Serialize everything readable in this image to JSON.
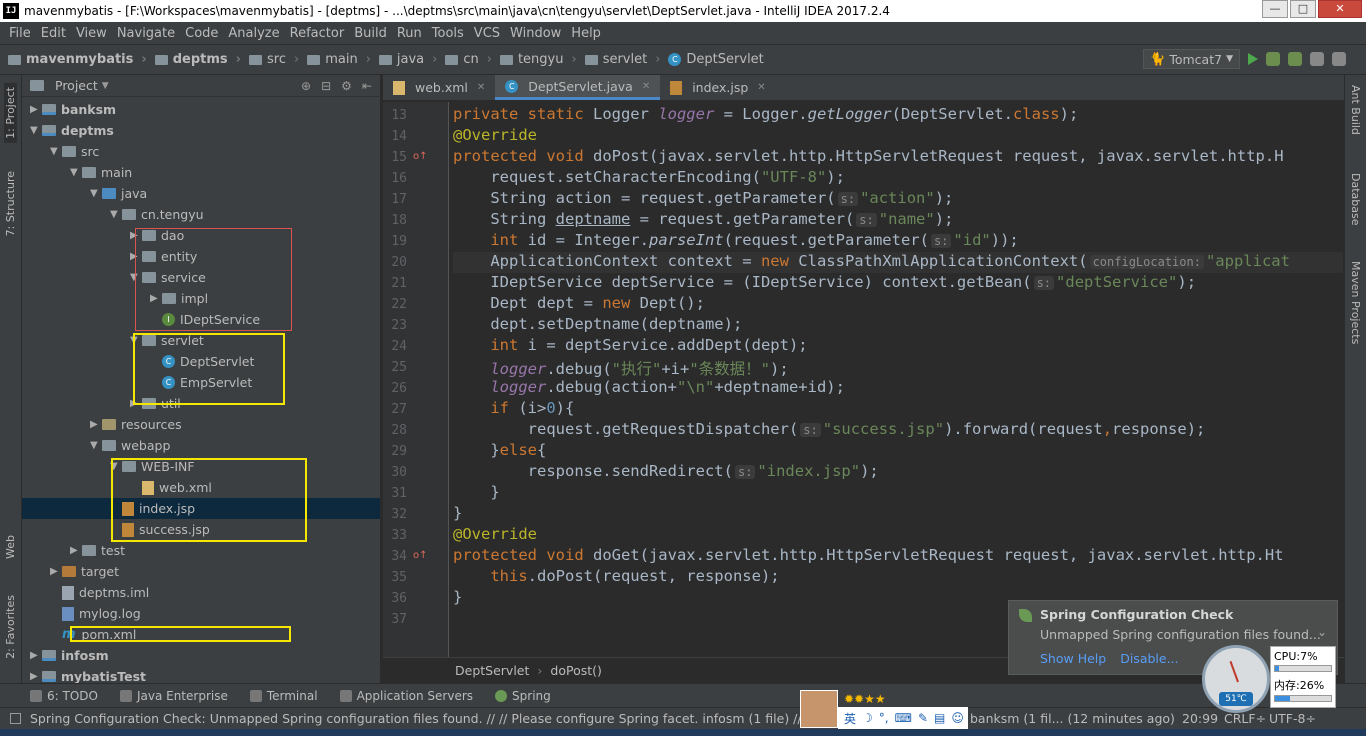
{
  "window": {
    "title": "mavenmybatis - [F:\\Workspaces\\mavenmybatis] - [deptms] - ...\\deptms\\src\\main\\java\\cn\\tengyu\\servlet\\DeptServlet.java - IntelliJ IDEA 2017.2.4",
    "logo": "IJ",
    "buttons": {
      "minimize": "—",
      "maximize": "□",
      "close": "✕"
    }
  },
  "menu": [
    "File",
    "Edit",
    "View",
    "Navigate",
    "Code",
    "Analyze",
    "Refactor",
    "Build",
    "Run",
    "Tools",
    "VCS",
    "Window",
    "Help"
  ],
  "breadcrumbs": [
    "mavenmybatis",
    "deptms",
    "src",
    "main",
    "java",
    "cn",
    "tengyu",
    "servlet",
    "DeptServlet"
  ],
  "run_config": "Tomcat7",
  "left_strip": {
    "project": "1: Project",
    "structure": "7: Structure",
    "web": "Web",
    "favorites": "2: Favorites"
  },
  "right_strip": {
    "ant": "Ant Build",
    "database": "Database",
    "maven": "Maven Projects"
  },
  "project_panel": {
    "title": "Project",
    "items": [
      {
        "label": "banksm",
        "depth": 1,
        "kind": "module",
        "expanded": false,
        "bold": true
      },
      {
        "label": "deptms",
        "depth": 1,
        "kind": "module",
        "expanded": true,
        "bold": true
      },
      {
        "label": "src",
        "depth": 2,
        "kind": "folder",
        "expanded": true
      },
      {
        "label": "main",
        "depth": 3,
        "kind": "folder",
        "expanded": true
      },
      {
        "label": "java",
        "depth": 4,
        "kind": "src",
        "expanded": true
      },
      {
        "label": "cn.tengyu",
        "depth": 5,
        "kind": "package",
        "expanded": true
      },
      {
        "label": "dao",
        "depth": 6,
        "kind": "package",
        "expanded": false
      },
      {
        "label": "entity",
        "depth": 6,
        "kind": "package",
        "expanded": false
      },
      {
        "label": "service",
        "depth": 6,
        "kind": "package",
        "expanded": true
      },
      {
        "label": "impl",
        "depth": 7,
        "kind": "package",
        "expanded": false
      },
      {
        "label": "IDeptService",
        "depth": 7,
        "kind": "interface"
      },
      {
        "label": "servlet",
        "depth": 6,
        "kind": "package",
        "expanded": true
      },
      {
        "label": "DeptServlet",
        "depth": 7,
        "kind": "class"
      },
      {
        "label": "EmpServlet",
        "depth": 7,
        "kind": "class"
      },
      {
        "label": "util",
        "depth": 6,
        "kind": "package",
        "expanded": false
      },
      {
        "label": "resources",
        "depth": 4,
        "kind": "res",
        "expanded": false
      },
      {
        "label": "webapp",
        "depth": 4,
        "kind": "folder",
        "expanded": true
      },
      {
        "label": "WEB-INF",
        "depth": 5,
        "kind": "folder",
        "expanded": true
      },
      {
        "label": "web.xml",
        "depth": 6,
        "kind": "xml"
      },
      {
        "label": "index.jsp",
        "depth": 5,
        "kind": "jsp",
        "selected": true
      },
      {
        "label": "success.jsp",
        "depth": 5,
        "kind": "jsp"
      },
      {
        "label": "test",
        "depth": 3,
        "kind": "folder",
        "expanded": false
      },
      {
        "label": "target",
        "depth": 2,
        "kind": "target",
        "expanded": false
      },
      {
        "label": "deptms.iml",
        "depth": 2,
        "kind": "iml"
      },
      {
        "label": "mylog.log",
        "depth": 2,
        "kind": "log"
      },
      {
        "label": "pom.xml",
        "depth": 2,
        "kind": "maven"
      },
      {
        "label": "infosm",
        "depth": 1,
        "kind": "module",
        "expanded": false,
        "bold": true
      },
      {
        "label": "mybatisTest",
        "depth": 1,
        "kind": "module",
        "expanded": false,
        "bold": true
      }
    ]
  },
  "editor_tabs": [
    {
      "label": "web.xml",
      "active": false
    },
    {
      "label": "DeptServlet.java",
      "active": true
    },
    {
      "label": "index.jsp",
      "active": false
    }
  ],
  "code_lines": [
    {
      "n": "13",
      "t": [
        [
          "kw",
          "private static "
        ],
        [
          "",
          "Logger "
        ],
        [
          "fld",
          "logger"
        ],
        [
          "",
          " = Logger."
        ],
        [
          "ital",
          "getLogger"
        ],
        [
          "",
          "(DeptServlet."
        ],
        [
          "kw",
          "class"
        ],
        [
          "",
          ");"
        ]
      ]
    },
    {
      "n": "14",
      "t": [
        [
          "ann",
          "@Override"
        ]
      ]
    },
    {
      "n": "15",
      "mark": "o↑",
      "t": [
        [
          "kw",
          "protected void "
        ],
        [
          "",
          "doPost(javax.servlet.http.HttpServletRequest request, javax.servlet.http.H"
        ]
      ]
    },
    {
      "n": "16",
      "t": [
        [
          "",
          "    request.setCharacterEncoding("
        ],
        [
          "str",
          "\"UTF-8\""
        ],
        [
          "",
          ");"
        ]
      ]
    },
    {
      "n": "17",
      "t": [
        [
          "",
          "    String action = request.getParameter("
        ],
        [
          "hint",
          "s:"
        ],
        [
          "str",
          "\"action\""
        ],
        [
          "",
          ");"
        ]
      ]
    },
    {
      "n": "18",
      "t": [
        [
          "",
          "    String "
        ],
        [
          "u",
          "deptname"
        ],
        [
          "",
          " = request.getParameter("
        ],
        [
          "hint",
          "s:"
        ],
        [
          "str",
          "\"name\""
        ],
        [
          "",
          ");"
        ]
      ]
    },
    {
      "n": "19",
      "t": [
        [
          "kw",
          "    int "
        ],
        [
          "",
          "id = Integer."
        ],
        [
          "ital",
          "parseInt"
        ],
        [
          "",
          "(request.getParameter("
        ],
        [
          "hint",
          "s:"
        ],
        [
          "str",
          "\"id\""
        ],
        [
          "",
          "));"
        ]
      ]
    },
    {
      "n": "20",
      "hl": true,
      "t": [
        [
          "",
          "    ApplicationContext context = "
        ],
        [
          "kw",
          "new "
        ],
        [
          "",
          "ClassPathXmlApplicationContext("
        ],
        [
          "hint",
          "configLocation:"
        ],
        [
          "str",
          "\"applicat"
        ]
      ]
    },
    {
      "n": "21",
      "t": [
        [
          "",
          "    IDeptService deptService = (IDeptService) context.getBean("
        ],
        [
          "hint",
          "s:"
        ],
        [
          "str",
          "\"deptService\""
        ],
        [
          "",
          ");"
        ]
      ]
    },
    {
      "n": "22",
      "t": [
        [
          "",
          "    Dept dept = "
        ],
        [
          "kw",
          "new "
        ],
        [
          "",
          "Dept();"
        ]
      ]
    },
    {
      "n": "23",
      "t": [
        [
          "",
          "    dept.setDeptname(deptname);"
        ]
      ]
    },
    {
      "n": "24",
      "t": [
        [
          "kw",
          "    int "
        ],
        [
          "",
          "i = deptService.addDept(dept);"
        ]
      ]
    },
    {
      "n": "25",
      "t": [
        [
          "fld",
          "    logger"
        ],
        [
          "",
          ".debug("
        ],
        [
          "str",
          "\"执行\""
        ],
        [
          "",
          "+i+"
        ],
        [
          "str",
          "\"条数据！\""
        ],
        [
          "",
          ");"
        ]
      ]
    },
    {
      "n": "26",
      "t": [
        [
          "fld",
          "    logger"
        ],
        [
          "",
          ".debug(action+"
        ],
        [
          "str",
          "\"\\n\""
        ],
        [
          "",
          "+deptname+id);"
        ]
      ]
    },
    {
      "n": "27",
      "t": [
        [
          "kw",
          "    if "
        ],
        [
          "",
          "(i>"
        ],
        [
          "num",
          "0"
        ],
        [
          "",
          "){"
        ]
      ]
    },
    {
      "n": "28",
      "t": [
        [
          "",
          "        request.getRequestDispatcher("
        ],
        [
          "hint",
          "s:"
        ],
        [
          "str",
          "\"success.jsp\""
        ],
        [
          "",
          ").forward(request"
        ],
        [
          "kw",
          ","
        ],
        [
          "",
          "response);"
        ]
      ]
    },
    {
      "n": "29",
      "t": [
        [
          "",
          "    }"
        ],
        [
          "kw",
          "else"
        ],
        [
          "",
          "{"
        ]
      ]
    },
    {
      "n": "30",
      "t": [
        [
          "",
          "        response.sendRedirect("
        ],
        [
          "hint",
          "s:"
        ],
        [
          "str",
          "\"index.jsp\""
        ],
        [
          "",
          ");"
        ]
      ]
    },
    {
      "n": "31",
      "t": [
        [
          "",
          "    }"
        ]
      ]
    },
    {
      "n": "32",
      "t": [
        [
          "",
          "}"
        ]
      ]
    },
    {
      "n": "33",
      "t": [
        [
          "ann",
          "@Override"
        ]
      ]
    },
    {
      "n": "34",
      "mark": "o↑",
      "t": [
        [
          "kw",
          "protected void "
        ],
        [
          "",
          "doGet(javax.servlet.http.HttpServletRequest request, javax.servlet.http.Ht"
        ]
      ]
    },
    {
      "n": "35",
      "t": [
        [
          "kw",
          "    this"
        ],
        [
          "",
          ".doPost(request, response);"
        ]
      ]
    },
    {
      "n": "36",
      "t": [
        [
          "",
          "}"
        ]
      ]
    },
    {
      "n": "37",
      "t": [
        [
          "",
          ""
        ]
      ]
    }
  ],
  "editor_breadcrumb": [
    "DeptServlet",
    "doPost()"
  ],
  "bottom_tools": [
    "6: TODO",
    "Java Enterprise",
    "Terminal",
    "Application Servers",
    "Spring"
  ],
  "status": {
    "message": "Spring Configuration Check: Unmapped Spring configuration files found. // // Please configure Spring facet. infosm (1 file) // Spring",
    "vcs": "banksm (1 fil... (12 minutes ago)",
    "position": "20:99",
    "line_sep": "CRLF÷",
    "encoding": "UTF-8÷"
  },
  "notification": {
    "title": "Spring Configuration Check",
    "body": "Unmapped Spring configuration files found...",
    "actions": [
      "Show Help",
      "Disable..."
    ]
  },
  "monitor": {
    "temp": "51℃",
    "cpu_label": "CPU:7%",
    "cpu_fraction": 0.07,
    "mem_label": "内存:26%",
    "mem_fraction": 0.26
  },
  "ime": {
    "lang": "英"
  }
}
